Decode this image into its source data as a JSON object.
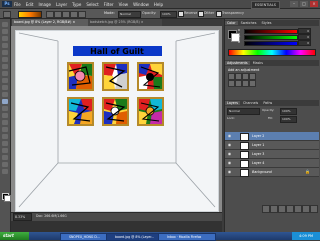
{
  "app": {
    "logo": "Ps",
    "workspace": "ESSENTIALS"
  },
  "menu": [
    "File",
    "Edit",
    "Image",
    "Layer",
    "Type",
    "Select",
    "Filter",
    "View",
    "Window",
    "Help"
  ],
  "window_controls": {
    "minimize": "–",
    "maximize": "□",
    "close": "×"
  },
  "options_bar": {
    "mode_label": "Mode:",
    "mode_value": "Normal",
    "opacity_label": "Opacity:",
    "opacity_value": "100%",
    "reverse_label": "Reverse",
    "dither_label": "Dither",
    "transparency_label": "Transparency"
  },
  "tabs": [
    {
      "label": "board.jpg @ 8% (Layer 2, RGB/8#) ×"
    },
    {
      "label": "badsketch.jpg @ 25% (RGB/8) ×"
    }
  ],
  "document": {
    "title": "Hall of Guilt"
  },
  "statusbar": {
    "zoom": "8.33%",
    "info": "Doc: 266.6M/1.66G"
  },
  "panels": {
    "color": {
      "tabs": [
        "Color",
        "Swatches",
        "Styles"
      ],
      "r": "0",
      "g": "0",
      "b": "0"
    },
    "adjustments": {
      "tabs": [
        "Adjustments",
        "Masks"
      ],
      "add": "Add an adjustment"
    },
    "layers": {
      "tabs": [
        "Layers",
        "Channels",
        "Paths"
      ],
      "blend_mode": "Normal",
      "opacity_label": "Opacity:",
      "opacity": "100%",
      "lock_label": "Lock:",
      "fill_label": "Fill:",
      "fill": "100%",
      "items": [
        {
          "name": "Layer 2",
          "selected": true
        },
        {
          "name": "Layer 1",
          "selected": false
        },
        {
          "name": "Layer 3",
          "selected": false
        },
        {
          "name": "Layer 4",
          "selected": false
        },
        {
          "name": "Background",
          "selected": false,
          "locked": true
        }
      ]
    }
  },
  "taskbar": {
    "start": "start",
    "tasks": [
      {
        "label": "SNOPEX_HONG D..."
      },
      {
        "label": "board.jpg @ 8% (Layer..."
      },
      {
        "label": "Inbox · Mozilla Firefox"
      }
    ],
    "time": "4:09 PM"
  }
}
